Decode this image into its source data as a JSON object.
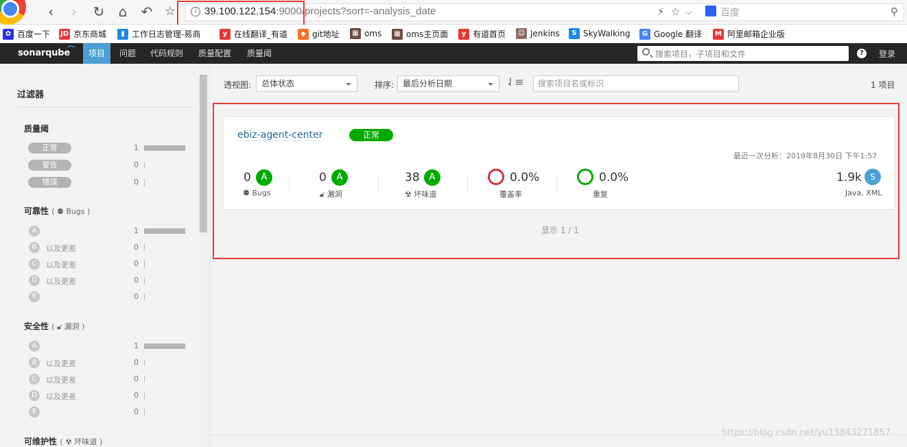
{
  "browser": {
    "url_host": "39.100.122.154",
    "url_port": ":9000/",
    "url_path": "projects?sort=-analysis_date",
    "search_engine": "百度"
  },
  "bookmarks": [
    {
      "label": "百度一下",
      "icon": "paw-icon",
      "color": "#2932e1"
    },
    {
      "label": "京东商城",
      "icon": "jd-icon",
      "color": "#e4393c"
    },
    {
      "label": "工作日志管理-易商",
      "icon": "bookmark-icon",
      "color": "#1e88e5"
    },
    {
      "label": "在线翻译_有道",
      "icon": "youdao-icon",
      "color": "#e53935"
    },
    {
      "label": "git地址",
      "icon": "gitlab-icon",
      "color": "#fc6d26"
    },
    {
      "label": "oms",
      "icon": "chart-icon",
      "color": "#6d4c41"
    },
    {
      "label": "oms主页面",
      "icon": "chart-icon",
      "color": "#6d4c41"
    },
    {
      "label": "有道首页",
      "icon": "youdao-icon",
      "color": "#e53935"
    },
    {
      "label": "Jenkins",
      "icon": "jenkins-icon",
      "color": "#8d6e63"
    },
    {
      "label": "SkyWalking",
      "icon": "skywalking-icon",
      "color": "#1e88e5"
    },
    {
      "label": "Google 翻译",
      "icon": "translate-icon",
      "color": "#4285f4"
    },
    {
      "label": "阿里邮箱企业版",
      "icon": "mail-icon",
      "color": "#e53935"
    }
  ],
  "navbar": {
    "logo": "sonarqube",
    "items": [
      "项目",
      "问题",
      "代码规则",
      "质量配置",
      "质量阈"
    ],
    "search_placeholder": "搜索项目，子项目和文件",
    "help": "?",
    "login": "登录"
  },
  "sidebar": {
    "title": "过滤器",
    "quality_gate": {
      "title": "质量阈",
      "items": [
        {
          "label": "正常",
          "count": "1",
          "share": 1
        },
        {
          "label": "警告",
          "count": "0",
          "share": 0
        },
        {
          "label": "错误",
          "count": "0",
          "share": 0
        }
      ]
    },
    "reliability": {
      "title": "可靠性",
      "sub": "Bugs",
      "items": [
        {
          "grade": "A",
          "text": "",
          "count": "1",
          "share": 1
        },
        {
          "grade": "B",
          "text": "以及更差",
          "count": "0",
          "share": 0
        },
        {
          "grade": "C",
          "text": "以及更差",
          "count": "0",
          "share": 0
        },
        {
          "grade": "D",
          "text": "以及更差",
          "count": "0",
          "share": 0
        },
        {
          "grade": "E",
          "text": "",
          "count": "0",
          "share": 0
        }
      ]
    },
    "security": {
      "title": "安全性",
      "sub": "漏洞",
      "items": [
        {
          "grade": "A",
          "text": "",
          "count": "1",
          "share": 1
        },
        {
          "grade": "B",
          "text": "以及更差",
          "count": "0",
          "share": 0
        },
        {
          "grade": "C",
          "text": "以及更差",
          "count": "0",
          "share": 0
        },
        {
          "grade": "D",
          "text": "以及更差",
          "count": "0",
          "share": 0
        },
        {
          "grade": "E",
          "text": "",
          "count": "0",
          "share": 0
        }
      ]
    },
    "maintainability": {
      "title": "可维护性",
      "sub": "坏味道"
    }
  },
  "toolbar": {
    "perspective_label": "透视图:",
    "perspective_value": "总体状态",
    "sort_label": "排序:",
    "sort_value": "最后分析日期",
    "search_placeholder": "搜索项目名或标识",
    "project_count": "1 项目"
  },
  "project": {
    "name": "ebiz-agent-center",
    "status": "正常",
    "last_analysis": "最近一次分析：2019年8月30日 下午1:57",
    "metrics": {
      "bugs": {
        "value": "0",
        "rating": "A",
        "label": "Bugs"
      },
      "vulnerabilities": {
        "value": "0",
        "rating": "A",
        "label": "漏洞"
      },
      "code_smells": {
        "value": "38",
        "rating": "A",
        "label": "坏味道"
      },
      "coverage": {
        "value": "0.0%",
        "label": "覆盖率"
      },
      "duplications": {
        "value": "0.0%",
        "label": "重复"
      },
      "size": {
        "value": "1.9k",
        "rating": "S",
        "languages": "Java, XML"
      }
    }
  },
  "pagination": "显示 1 / 1",
  "watermark": "https://blog.csdn.net/yu13843271857",
  "colors": {
    "accent": "#4b9fd5",
    "ok": "#00aa00",
    "error": "#d4333f",
    "highlight": "#e53935"
  }
}
